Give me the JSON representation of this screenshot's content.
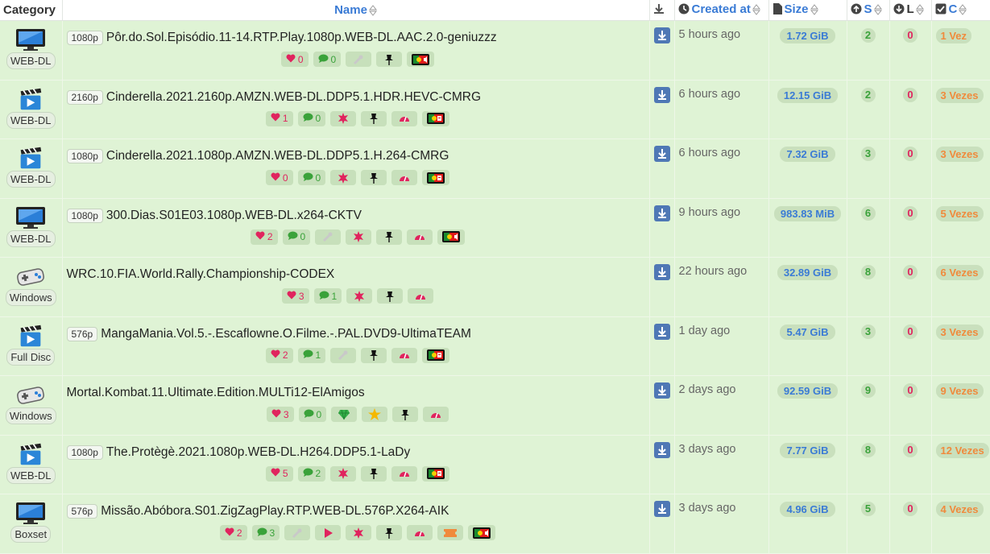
{
  "header": {
    "category": "Category",
    "name": "Name",
    "created": "Created at",
    "size": "Size",
    "seeders": "S",
    "leechers": "L",
    "completed": "C"
  },
  "rows": [
    {
      "category": "WEB-DL",
      "cat_icon": "tv-icon",
      "resolution": "1080p",
      "name": "Pôr.do.Sol.Episódio.11-14.RTP.Play.1080p.WEB-DL.AAC.2.0-geniuzzz",
      "likes": "0",
      "comments": "0",
      "created": "5 hours ago",
      "size": "1.72 GiB",
      "seeders": "2",
      "leechers": "0",
      "completed": "1 Vez"
    },
    {
      "category": "WEB-DL",
      "cat_icon": "clapperboard-icon",
      "resolution": "2160p",
      "name": "Cinderella.2021.2160p.AMZN.WEB-DL.DDP5.1.HDR.HEVC-CMRG",
      "likes": "1",
      "comments": "0",
      "created": "6 hours ago",
      "size": "12.15 GiB",
      "seeders": "2",
      "leechers": "0",
      "completed": "3 Vezes"
    },
    {
      "category": "WEB-DL",
      "cat_icon": "clapperboard-icon",
      "resolution": "1080p",
      "name": "Cinderella.2021.1080p.AMZN.WEB-DL.DDP5.1.H.264-CMRG",
      "likes": "0",
      "comments": "0",
      "created": "6 hours ago",
      "size": "7.32 GiB",
      "seeders": "3",
      "leechers": "0",
      "completed": "3 Vezes"
    },
    {
      "category": "WEB-DL",
      "cat_icon": "tv-icon",
      "resolution": "1080p",
      "name": "300.Dias.S01E03.1080p.WEB-DL.x264-CKTV",
      "likes": "2",
      "comments": "0",
      "created": "9 hours ago",
      "size": "983.83 MiB",
      "seeders": "6",
      "leechers": "0",
      "completed": "5 Vezes"
    },
    {
      "category": "Windows",
      "cat_icon": "gamepad-icon",
      "resolution": "",
      "name": "WRC.10.FIA.World.Rally.Championship-CODEX",
      "likes": "3",
      "comments": "1",
      "created": "22 hours ago",
      "size": "32.89 GiB",
      "seeders": "8",
      "leechers": "0",
      "completed": "6 Vezes"
    },
    {
      "category": "Full Disc",
      "cat_icon": "clapperboard-icon",
      "resolution": "576p",
      "name": "MangaMania.Vol.5.-.Escaflowne.O.Filme.-.PAL.DVD9-UltimaTEAM",
      "likes": "2",
      "comments": "1",
      "created": "1 day ago",
      "size": "5.47 GiB",
      "seeders": "3",
      "leechers": "0",
      "completed": "3 Vezes"
    },
    {
      "category": "Windows",
      "cat_icon": "gamepad-icon",
      "resolution": "",
      "name": "Mortal.Kombat.11.Ultimate.Edition.MULTi12-ElAmigos",
      "likes": "3",
      "comments": "0",
      "created": "2 days ago",
      "size": "92.59 GiB",
      "seeders": "9",
      "leechers": "0",
      "completed": "9 Vezes"
    },
    {
      "category": "WEB-DL",
      "cat_icon": "clapperboard-icon",
      "resolution": "1080p",
      "name": "The.Protègè.2021.1080p.WEB-DL.H264.DDP5.1-LaDy",
      "likes": "5",
      "comments": "2",
      "created": "3 days ago",
      "size": "7.77 GiB",
      "seeders": "8",
      "leechers": "0",
      "completed": "12 Vezes"
    },
    {
      "category": "Boxset",
      "cat_icon": "tv-icon",
      "resolution": "576p",
      "name": "Missão.Abóbora.S01.ZigZagPlay.RTP.WEB-DL.576P.X264-AIK",
      "likes": "2",
      "comments": "3",
      "created": "3 days ago",
      "size": "4.96 GiB",
      "seeders": "5",
      "leechers": "0",
      "completed": "4 Vezes"
    }
  ],
  "row_badges": [
    [
      "wrench",
      "pin",
      "flag-audio"
    ],
    [
      "burst",
      "pin",
      "speed",
      "flag-sub"
    ],
    [
      "burst",
      "pin",
      "speed",
      "flag-sub"
    ],
    [
      "wrench",
      "burst",
      "pin",
      "speed",
      "flag-audio"
    ],
    [
      "burst",
      "pin",
      "speed"
    ],
    [
      "wrench",
      "pin",
      "speed",
      "flag-sub"
    ],
    [
      "diamond",
      "star",
      "pin",
      "speed"
    ],
    [
      "burst",
      "pin",
      "speed",
      "flag-sub"
    ],
    [
      "wrench",
      "play",
      "burst",
      "pin",
      "speed",
      "ticket",
      "flag-audio"
    ]
  ],
  "colors": {
    "row_bg": "#dff3d5",
    "link": "#3a7bd5",
    "like": "#e0245e",
    "comment": "#3aa23a",
    "completed": "#f08a3c"
  }
}
